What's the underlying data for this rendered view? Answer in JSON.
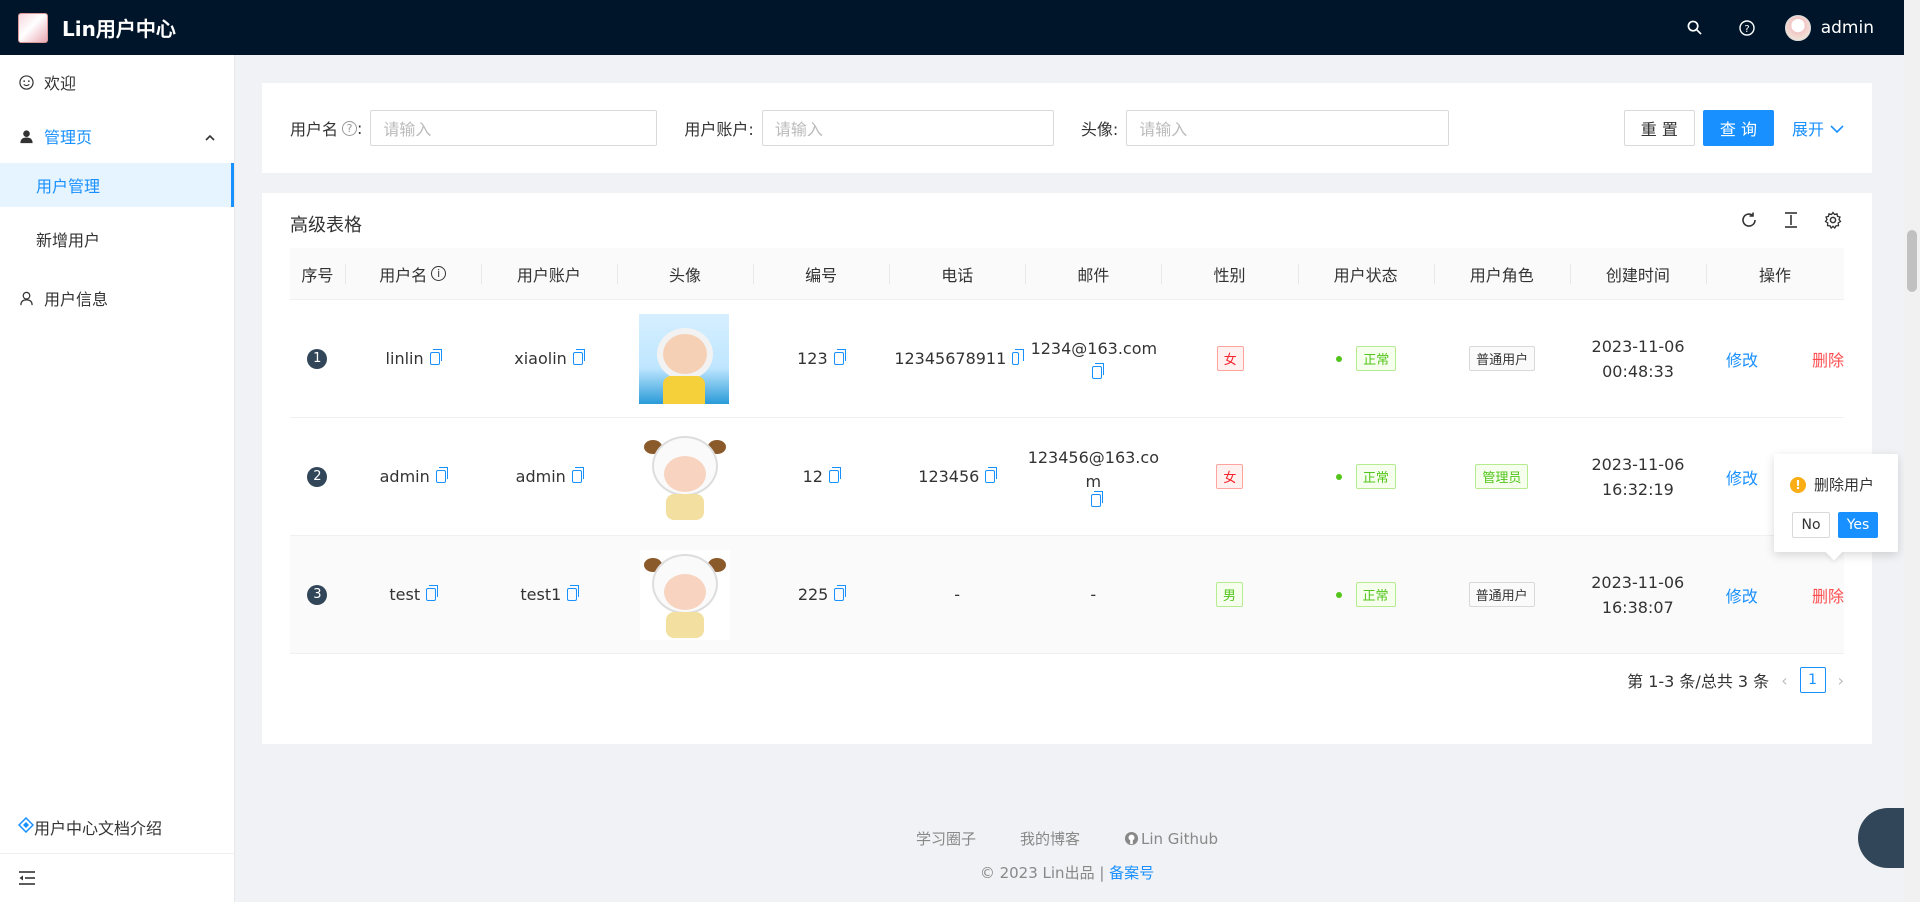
{
  "header": {
    "app_title": "Lin用户中心",
    "username": "admin"
  },
  "sidebar": {
    "items": [
      {
        "label": "欢迎"
      },
      {
        "label": "管理页"
      },
      {
        "label": "用户管理"
      },
      {
        "label": "新增用户"
      },
      {
        "label": "用户信息"
      }
    ],
    "doc_link": "用户中心文档介绍"
  },
  "search": {
    "username_label": "用户名",
    "username_placeholder": "请输入",
    "account_label": "用户账户:",
    "account_placeholder": "请输入",
    "avatar_label": "头像:",
    "avatar_placeholder": "请输入",
    "reset_label": "重 置",
    "query_label": "查 询",
    "expand_label": "展开"
  },
  "table": {
    "title": "高级表格",
    "columns": [
      "序号",
      "用户名",
      "用户账户",
      "头像",
      "编号",
      "电话",
      "邮件",
      "性别",
      "用户状态",
      "用户角色",
      "创建时间",
      "操作"
    ],
    "rows": [
      {
        "index": "1",
        "username": "linlin",
        "account": "xiaolin",
        "code": "123",
        "phone": "12345678911",
        "email": "1234@163.com",
        "gender": "女",
        "status": "正常",
        "role": "普通用户",
        "date": "2023-11-06",
        "time": "00:48:33",
        "edit": "修改",
        "delete": "删除"
      },
      {
        "index": "2",
        "username": "admin",
        "account": "admin",
        "code": "12",
        "phone": "123456",
        "email": "123456@163.co m",
        "gender": "女",
        "status": "正常",
        "role": "管理员",
        "date": "2023-11-06",
        "time": "16:32:19",
        "edit": "修改",
        "delete": "删除"
      },
      {
        "index": "3",
        "username": "test",
        "account": "test1",
        "code": "225",
        "phone": "-",
        "email": "-",
        "gender": "男",
        "status": "正常",
        "role": "普通用户",
        "date": "2023-11-06",
        "time": "16:38:07",
        "edit": "修改",
        "delete": "删除"
      }
    ],
    "pagination_text": "第 1-3 条/总共 3 条",
    "current_page": "1"
  },
  "popconfirm": {
    "message": "删除用户",
    "no_label": "No",
    "yes_label": "Yes"
  },
  "footer": {
    "links": [
      "学习圈子",
      "我的博客",
      "Lin Github"
    ],
    "copyright": "2023 Lin出品 |",
    "beian": "备案号"
  },
  "colors": {
    "primary": "#1890ff",
    "header_bg": "#001529",
    "danger": "#ff4d4f",
    "success": "#52c41a"
  }
}
